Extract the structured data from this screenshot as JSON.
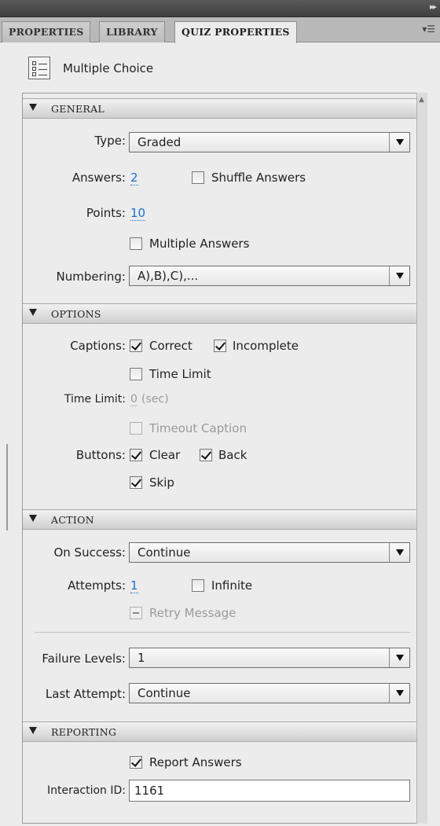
{
  "tabs": [
    "PROPERTIES",
    "LIBRARY",
    "QUIZ PROPERTIES"
  ],
  "header": {
    "title": "Multiple Choice",
    "icon": "multiple-choice-icon"
  },
  "general": {
    "title": "GENERAL",
    "type_label": "Type:",
    "type_value": "Graded",
    "answers_label": "Answers:",
    "answers_value": "2",
    "shuffle_label": "Shuffle Answers",
    "shuffle_checked": false,
    "points_label": "Points:",
    "points_value": "10",
    "multiple_label": "Multiple Answers",
    "multiple_checked": false,
    "numbering_label": "Numbering:",
    "numbering_value": "A),B),C),..."
  },
  "options": {
    "title": "OPTIONS",
    "captions_label": "Captions:",
    "correct_label": "Correct",
    "correct_checked": true,
    "incomplete_label": "Incomplete",
    "incomplete_checked": true,
    "timelimit_cb_label": "Time Limit",
    "timelimit_checked": false,
    "timelimit_label": "Time Limit:",
    "timelimit_value": "0",
    "timelimit_unit": "(sec)",
    "timeout_label": "Timeout Caption",
    "buttons_label": "Buttons:",
    "clear_label": "Clear",
    "clear_checked": true,
    "back_label": "Back",
    "back_checked": true,
    "skip_label": "Skip",
    "skip_checked": true
  },
  "action": {
    "title": "ACTION",
    "success_label": "On Success:",
    "success_value": "Continue",
    "attempts_label": "Attempts:",
    "attempts_value": "1",
    "infinite_label": "Infinite",
    "infinite_checked": false,
    "retry_label": "Retry Message",
    "failure_label": "Failure Levels:",
    "failure_value": "1",
    "last_label": "Last Attempt:",
    "last_value": "Continue"
  },
  "reporting": {
    "title": "REPORTING",
    "report_label": "Report Answers",
    "report_checked": true,
    "interaction_label": "Interaction ID:",
    "interaction_value": "1161"
  }
}
